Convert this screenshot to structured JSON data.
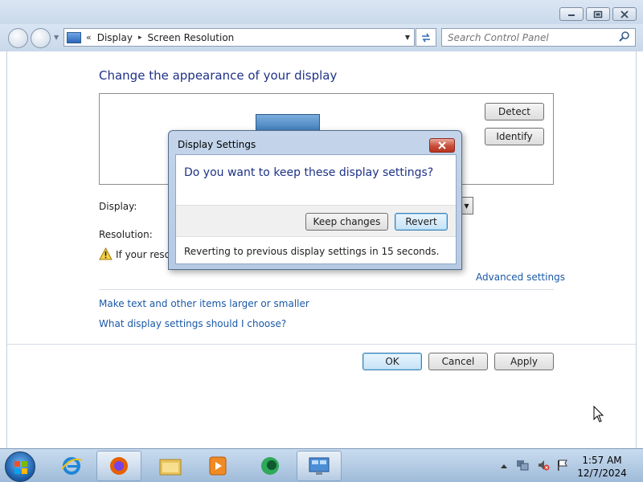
{
  "window": {
    "buttons": {
      "minimize": "minimize",
      "maximize": "maximize",
      "close": "close"
    }
  },
  "navbar": {
    "chevron": "«",
    "breadcrumb": [
      "Display",
      "Screen Resolution"
    ],
    "separator": "▸",
    "search_placeholder": "Search Control Panel"
  },
  "page": {
    "title": "Change the appearance of your display",
    "detect_label": "Detect",
    "identify_label": "Identify",
    "display_label": "Display:",
    "resolution_label": "Resolution:",
    "warning_text": "If your resolu",
    "advanced_link": "Advanced settings",
    "link_text_size": "Make text and other items larger or smaller",
    "link_which_settings": "What display settings should I choose?",
    "ok_label": "OK",
    "cancel_label": "Cancel",
    "apply_label": "Apply"
  },
  "dialog": {
    "title": "Display Settings",
    "question": "Do you want to keep these display settings?",
    "keep_label": "Keep changes",
    "revert_label": "Revert",
    "countdown_text": "Reverting to previous display settings in 15 seconds."
  },
  "taskbar": {
    "time": "1:57 AM",
    "date": "12/7/2024",
    "apps": [
      "internet-explorer-icon",
      "firefox-icon",
      "file-explorer-icon",
      "media-player-icon",
      "media-center-icon",
      "screen-resolution-icon"
    ]
  },
  "colors": {
    "title_blue": "#1e3287",
    "link_blue": "#1a58a6",
    "taskbar": "#b3cbe5"
  }
}
